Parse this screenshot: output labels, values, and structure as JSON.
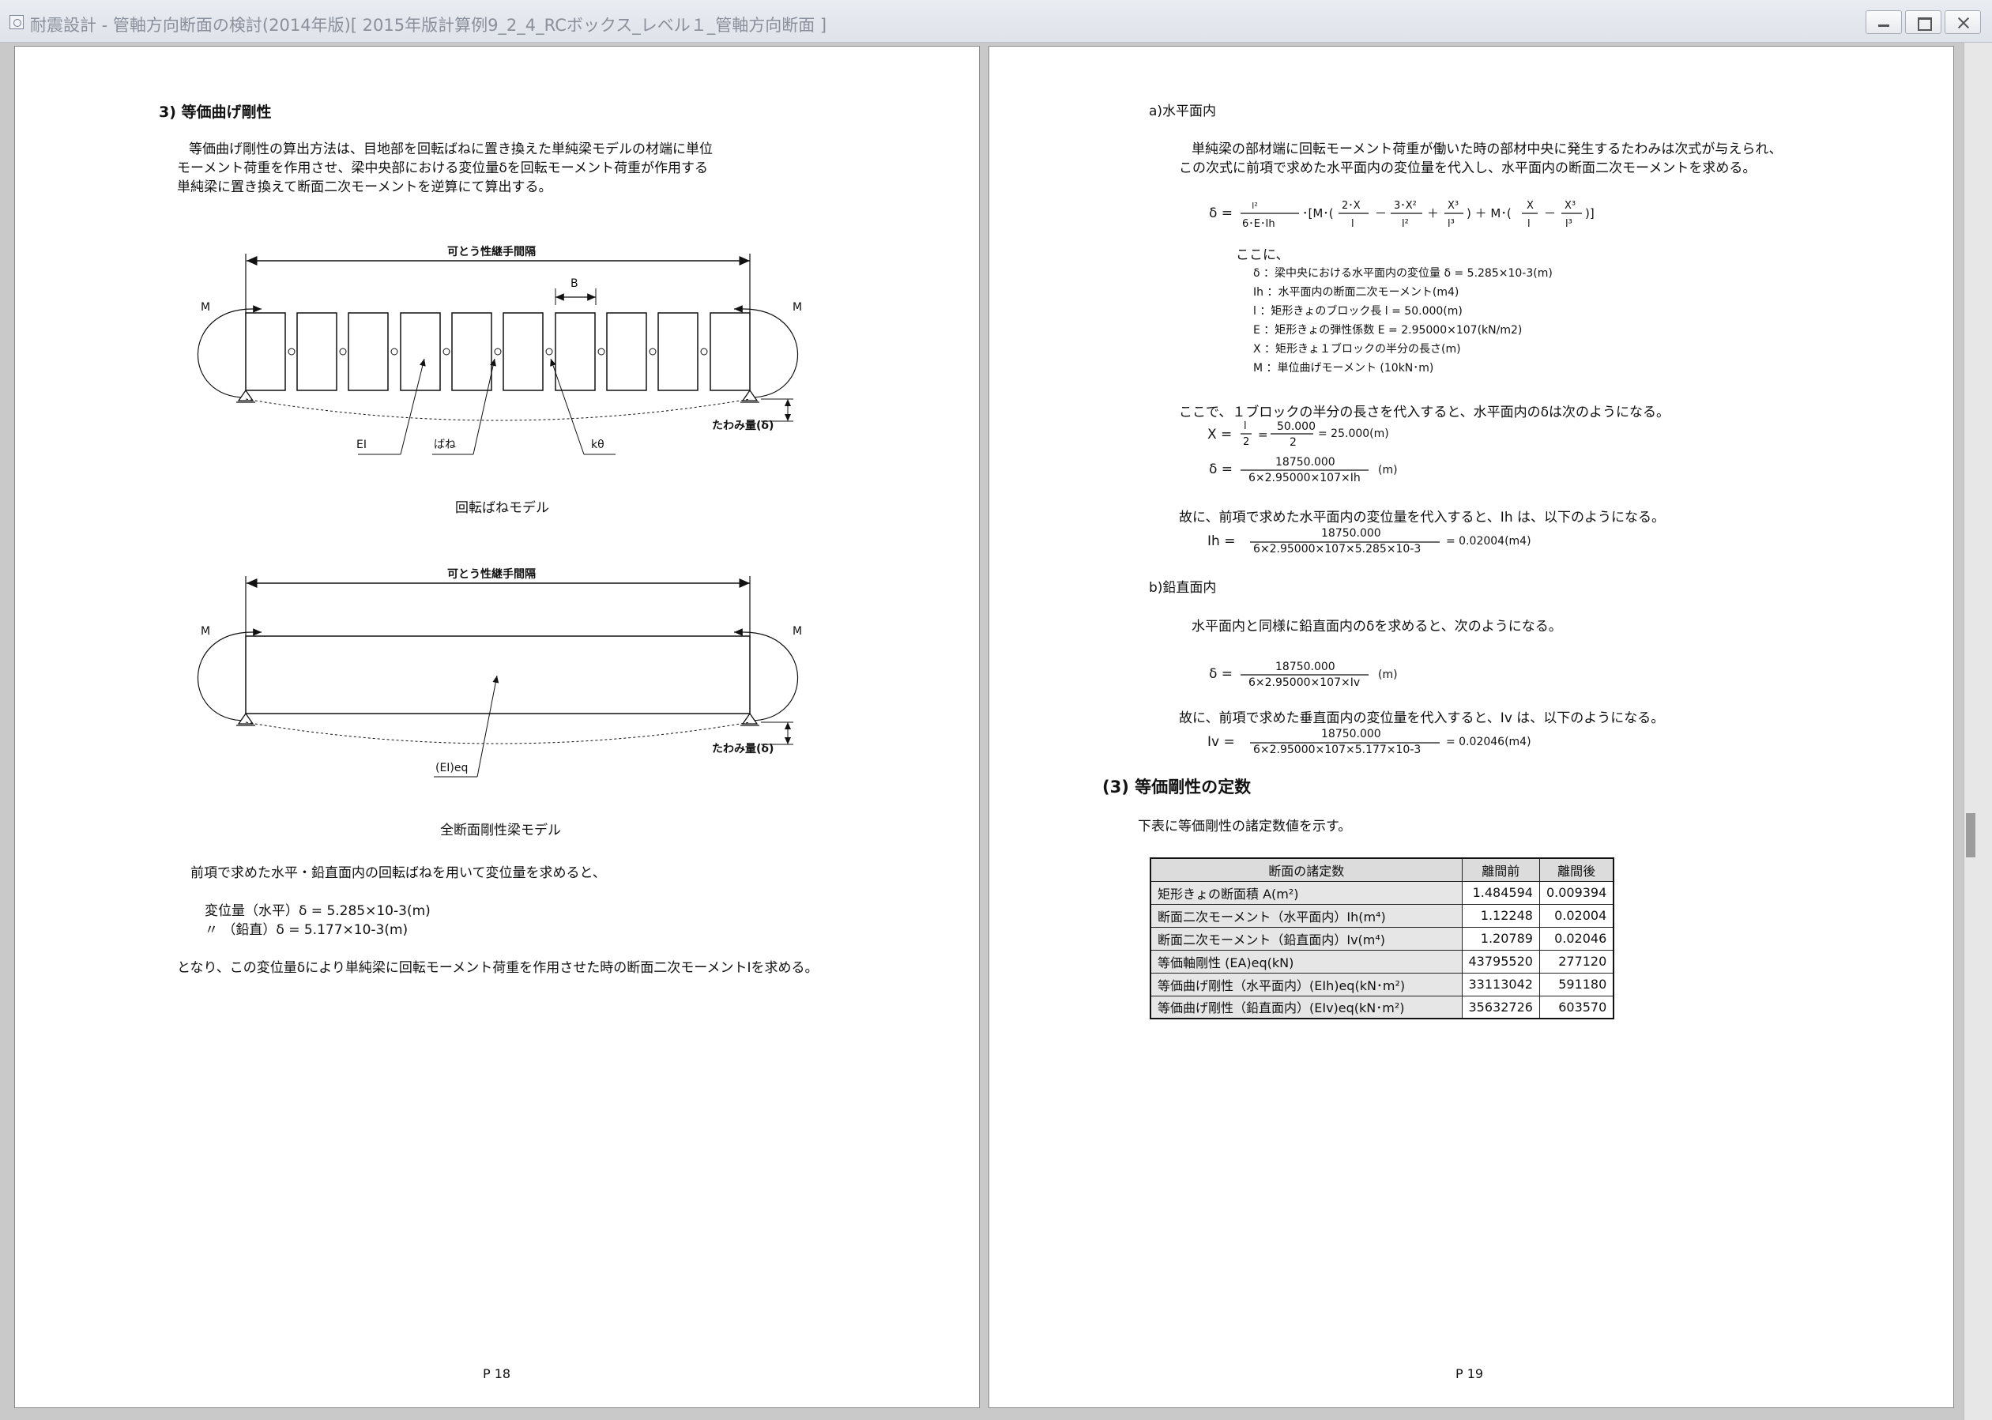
{
  "window": {
    "title": "耐震設計 - 管軸方向断面の検討(2014年版)[ 2015年版計算例9_2_4_RCボックス_レベル１_管軸方向断面 ]"
  },
  "page18": {
    "heading": "3)  等価曲げ剛性",
    "para": [
      "等価曲げ剛性の算出方法は、目地部を回転ばねに置き換えた単純梁モデルの材端に単位",
      "モーメント荷重を作用させ、梁中央部における変位量δを回転モーメント荷重が作用する",
      "単純梁に置き換えて断面二次モーメントを逆算にて算出する。"
    ],
    "fig1": {
      "span": "可とう性継手間隔",
      "b": "B",
      "m": "M",
      "defl": "たわみ量(δ)",
      "ei": "EI",
      "spring": "ばね",
      "ktheta": "kθ",
      "caption": "回転ばねモデル"
    },
    "fig2": {
      "span": "可とう性継手間隔",
      "m": "M",
      "defl": "たわみ量(δ)",
      "eieq": "(EI)eq",
      "caption": "全断面剛性梁モデル"
    },
    "intro": "前項で求めた水平・鉛直面内の回転ばねを用いて変位量を求めると、",
    "disp1": "変位量（水平）δ  = 5.285×10-3(m)",
    "disp2": "〃    （鉛直）δ  = 5.177×10-3(m)",
    "closing": "となり、この変位量δにより単純梁に回転モーメント荷重を作用させた時の断面二次モーメントIを求める。",
    "page_no": "P 18"
  },
  "page19": {
    "a_title": "a)水平面内",
    "a_para1": "単純梁の部材端に回転モーメント荷重が働いた時の部材中央に発生するたわみは次式が与えられ、",
    "a_para2": "この次式に前項で求めた水平面内の変位量を代入し、水平面内の断面二次モーメントを求める。",
    "where": "ここに、",
    "defs": [
      "δ  ：梁中央における水平面内の変位量  δ  = 5.285×10-3(m)",
      "Ih ：水平面内の断面二次モーメント(m4)",
      "l  ：矩形きょのブロック長 l = 50.000(m)",
      "E  ：矩形きょの弾性係数 E = 2.95000×107(kN/m2)",
      "X  ：矩形きょ１ブロックの半分の長さ(m)",
      "M  ：単位曲げモーメント (10kN･m)"
    ],
    "sub_line": "ここで、１ブロックの半分の長さを代入すると、水平面内のδは次のようになる。",
    "x_result": "= 25.000(m)",
    "x_num": "50.000",
    "x_den": "2",
    "d_num": "18750.000",
    "d_den_h": "6×2.95000×107×Ih",
    "unit_m": "(m)",
    "ih_line": "故に、前項で求めた水平面内の変位量を代入すると、Ih は、以下のようになる。",
    "ih_den": "6×2.95000×107×5.285×10-3",
    "ih_result": "= 0.02004(m4)",
    "b_title": "b)鉛直面内",
    "b_para": "水平面内と同様に鉛直面内のδを求めると、次のようになる。",
    "d_den_v": "6×2.95000×107×Iv",
    "iv_line": "故に、前項で求めた垂直面内の変位量を代入すると、Iv は、以下のようになる。",
    "iv_den": "6×2.95000×107×5.177×10-3",
    "iv_result": "= 0.02046(m4)",
    "sec3": "(3)  等価剛性の定数",
    "sec3_para": "下表に等価剛性の諸定数値を示す。",
    "table": {
      "headers": [
        "断面の諸定数",
        "離間前",
        "離間後"
      ],
      "rows": [
        {
          "label": "矩形きょの断面積 A(m²)",
          "before": "1.484594",
          "after": "0.009394"
        },
        {
          "label": "断面二次モーメント（水平面内）Ih(m⁴)",
          "before": "1.12248",
          "after": "0.02004"
        },
        {
          "label": "断面二次モーメント（鉛直面内）Iv(m⁴)",
          "before": "1.20789",
          "after": "0.02046"
        },
        {
          "label": "等価軸剛性 (EA)eq(kN)",
          "before": "43795520",
          "after": "277120"
        },
        {
          "label": "等価曲げ剛性（水平面内）(EIh)eq(kN･m²)",
          "before": "33113042",
          "after": "591180"
        },
        {
          "label": "等価曲げ剛性（鉛直面内）(EIv)eq(kN･m²)",
          "before": "35632726",
          "after": "603570"
        }
      ]
    },
    "page_no": "P 19"
  }
}
